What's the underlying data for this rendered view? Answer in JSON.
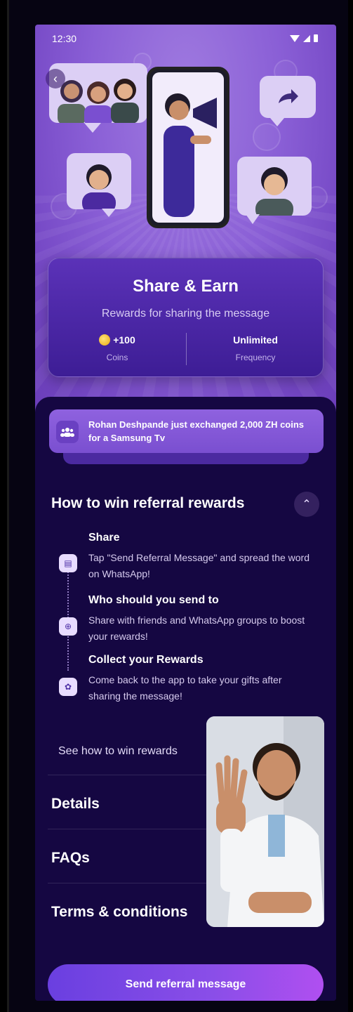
{
  "status_bar": {
    "time": "12:30"
  },
  "hero": {
    "back_icon": "chevron-left-icon",
    "share_arrow_icon": "share-arrow-icon",
    "megaphone_icon": "megaphone-icon"
  },
  "share_card": {
    "title": "Share & Earn",
    "subtitle": "Rewards for sharing the message",
    "coins_value": "+100",
    "coins_label": "Coins",
    "frequency_value": "Unlimited",
    "frequency_label": "Frequency"
  },
  "ticker": {
    "icon": "users-icon",
    "text": "Rohan Deshpande just exchanged 2,000 ZH coins for a Samsung Tv"
  },
  "how_to": {
    "title": "How to win referral rewards",
    "steps": [
      {
        "icon": "message-icon",
        "title": "Share",
        "desc": "Tap \"Send Referral Message\" and spread the word on WhatsApp!"
      },
      {
        "icon": "add-contact-icon",
        "title": "Who should you send to",
        "desc": "Share with friends and WhatsApp groups to boost your rewards!"
      },
      {
        "icon": "gift-icon",
        "title": "Collect your Rewards",
        "desc": "Come back to the app to take your gifts after sharing the message!"
      }
    ],
    "see_how": "See how to win rewards"
  },
  "links": {
    "details": "Details",
    "faqs": "FAQs",
    "terms": "Terms & conditions"
  },
  "cta": {
    "label": "Send referral message"
  },
  "colors": {
    "hero_purple": "#8a5fd6",
    "panel_dark": "#150742",
    "card": "#3d1d95",
    "accent": "#8a4ee8"
  }
}
